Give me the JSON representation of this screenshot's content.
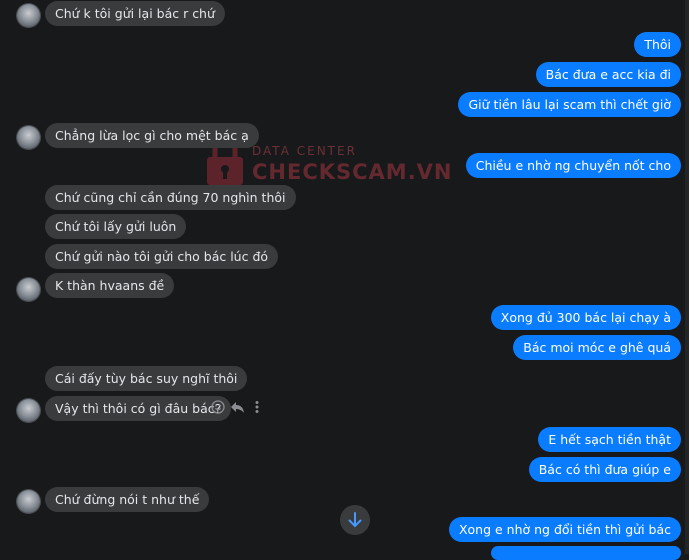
{
  "watermark": {
    "top": "DATA CENTER",
    "main": "CHECKSCAM.VN"
  },
  "messages": [
    {
      "dir": "in",
      "text": "Chứ k tôi gửi lại bác r chứ"
    },
    {
      "dir": "out",
      "text": "Thôi"
    },
    {
      "dir": "out",
      "text": "Bác đưa e acc kia đi"
    },
    {
      "dir": "out",
      "text": "Giữ tiền lâu lại scam thì chết giờ"
    },
    {
      "dir": "in",
      "text": "Chẳng lừa lọc gì cho mệt bác ạ"
    },
    {
      "dir": "out",
      "text": "Chiều e nhờ ng chuyển nốt cho"
    },
    {
      "dir": "in",
      "text": "Chứ cũng chỉ cần đúng 70 nghìn thôi"
    },
    {
      "dir": "in",
      "text": "Chứ tôi lấy gửi luôn"
    },
    {
      "dir": "in",
      "text": "Chứ gửi nào tôi gửi cho bác lúc đó"
    },
    {
      "dir": "in",
      "text": "K thàn hvaans đề"
    },
    {
      "dir": "out",
      "text": "Xong đủ 300 bác lại chạy à"
    },
    {
      "dir": "out",
      "text": "Bác moi móc e ghê quá"
    },
    {
      "dir": "in",
      "text": "Cái đấy tùy bác suy nghĩ thôi"
    },
    {
      "dir": "in",
      "text": "Vậy thì thôi có gì đâu bác?"
    },
    {
      "dir": "out",
      "text": "E hết sạch tiền thật"
    },
    {
      "dir": "out",
      "text": "Bác có thì đưa giúp e"
    },
    {
      "dir": "in",
      "text": "Chứ đừng nói t như thế"
    },
    {
      "dir": "out",
      "text": "Xong e nhờ ng đổi tiền thì gửi bác"
    }
  ],
  "icons": {
    "emoji": "smile-icon",
    "reply": "reply-icon",
    "more": "more-icon",
    "scroll": "arrow-down-icon"
  }
}
